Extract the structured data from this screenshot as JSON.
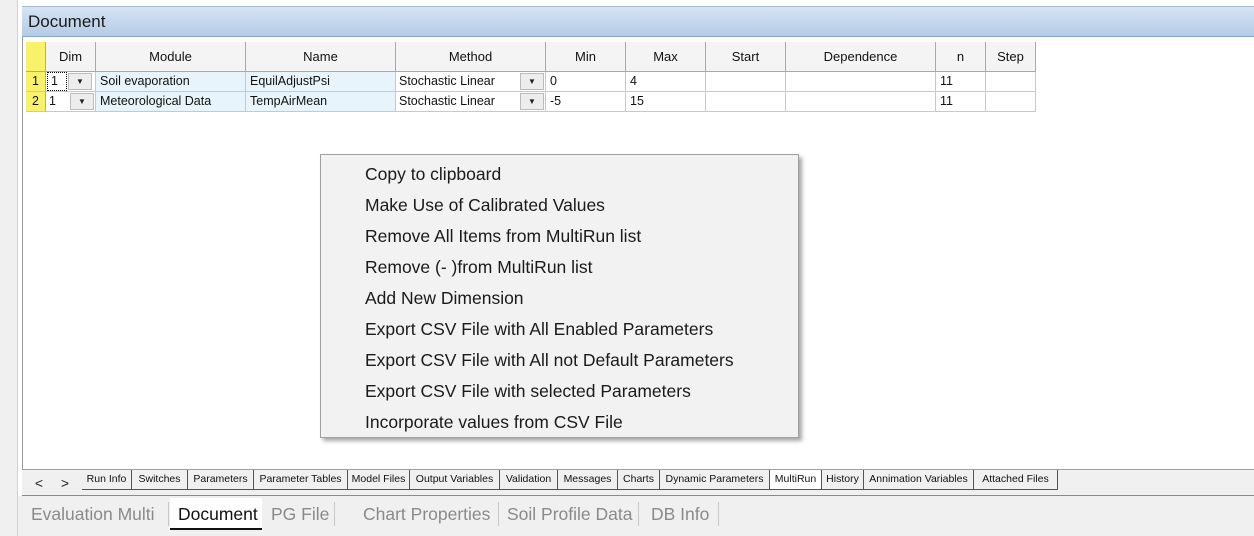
{
  "header": {
    "title": "Document"
  },
  "grid": {
    "columns": [
      "Dim",
      "Module",
      "Name",
      "Method",
      "Min",
      "Max",
      "Start",
      "Dependence",
      "n",
      "Step"
    ],
    "rows": [
      {
        "num": "1",
        "dim": "1",
        "module": "Soil evaporation",
        "name": "EquilAdjustPsi",
        "method": "Stochastic Linear",
        "min": "0",
        "max": "4",
        "start": "",
        "dependence": "",
        "n": "11",
        "step": ""
      },
      {
        "num": "2",
        "dim": "1",
        "module": "Meteorological Data",
        "name": "TempAirMean",
        "method": "Stochastic Linear",
        "min": "-5",
        "max": "15",
        "start": "",
        "dependence": "",
        "n": "11",
        "step": ""
      }
    ]
  },
  "context_menu": {
    "items": [
      "Copy to clipboard",
      "Make Use of Calibrated Values",
      "Remove All Items from MultiRun list",
      "Remove (- )from MultiRun list",
      "Add New Dimension",
      "Export CSV File with All Enabled Parameters",
      "Export CSV File with All not Default Parameters",
      "Export CSV File with selected Parameters",
      "Incorporate values from CSV File"
    ]
  },
  "tabs": {
    "prev": "<",
    "next": ">",
    "items": [
      "Run Info",
      "Switches",
      "Parameters",
      "Parameter Tables",
      "Model Files",
      "Output Variables",
      "Validation",
      "Messages",
      "Charts",
      "Dynamic Parameters",
      "MultiRun",
      "History",
      "Annimation Variables",
      "Attached Files"
    ],
    "active": "MultiRun"
  },
  "doc_tabs": {
    "items": [
      "Evaluation Multi",
      "Document",
      "PG File",
      "Chart Properties",
      "Soil Profile Data",
      "DB Info"
    ],
    "active": "Document"
  }
}
